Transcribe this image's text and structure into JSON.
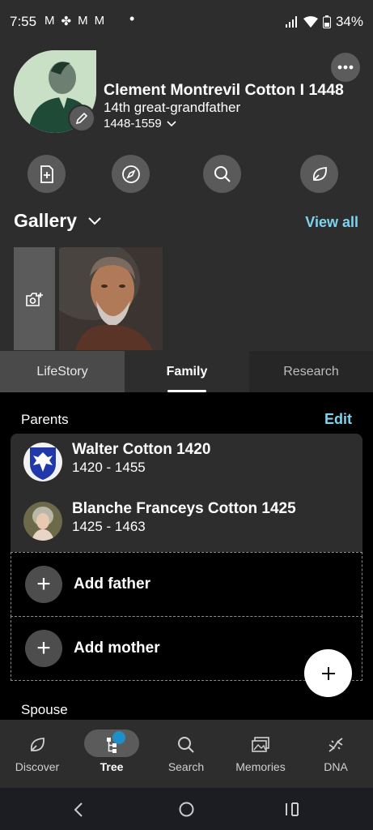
{
  "status": {
    "time": "7:55",
    "left_icons": [
      "M",
      "✤",
      "M",
      "M"
    ],
    "dot": "•",
    "battery": "34%"
  },
  "profile": {
    "name": "Clement Montrevil Cotton I 1448",
    "relation": "14th great-grandfather",
    "dates": "1448-1559"
  },
  "gallery": {
    "title": "Gallery",
    "view_all": "View all"
  },
  "tabs": [
    "LifeStory",
    "Family",
    "Research"
  ],
  "parents": {
    "title": "Parents",
    "edit": "Edit",
    "people": [
      {
        "name": "Walter Cotton 1420",
        "dates": "1420 - 1455"
      },
      {
        "name": "Blanche Franceys Cotton 1425",
        "dates": "1425 - 1463"
      }
    ],
    "add_father": "Add father",
    "add_mother": "Add mother"
  },
  "spouse": {
    "title": "Spouse"
  },
  "nav": [
    "Discover",
    "Tree",
    "Search",
    "Memories",
    "DNA"
  ],
  "colors": {
    "accent": "#7ed3ef",
    "notification": "#1f8fc9",
    "panel": "#2d2d2d"
  }
}
